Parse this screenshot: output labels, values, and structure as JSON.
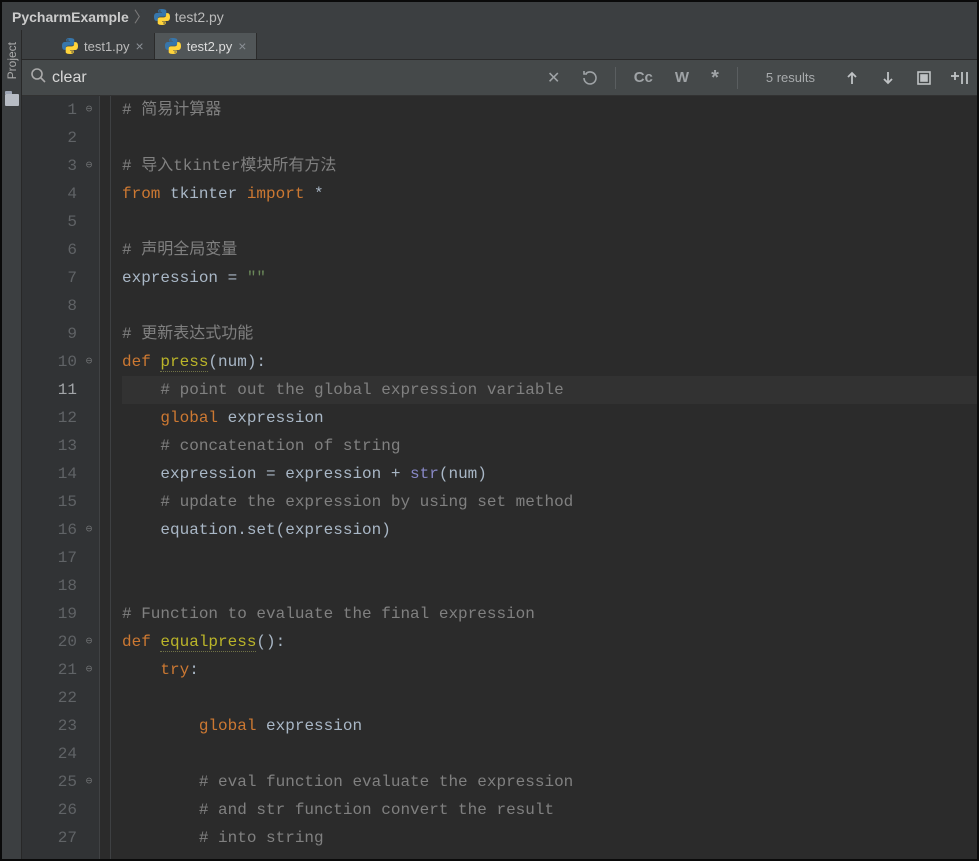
{
  "breadcrumb": {
    "project": "PycharmExample",
    "file": "test2.py"
  },
  "sidebar": {
    "project_label": "Project"
  },
  "tabs": [
    {
      "label": "test1.py",
      "active": false
    },
    {
      "label": "test2.py",
      "active": true
    }
  ],
  "findbar": {
    "query": "clear",
    "match_case": "Cc",
    "words": "W",
    "regex": "*",
    "results": "5 results"
  },
  "code": {
    "lines": [
      {
        "n": 1,
        "segs": [
          [
            "cm",
            "# 简易计算器"
          ]
        ]
      },
      {
        "n": 2,
        "segs": []
      },
      {
        "n": 3,
        "segs": [
          [
            "cm",
            "# 导入tkinter模块所有方法"
          ]
        ]
      },
      {
        "n": 4,
        "segs": [
          [
            "kw",
            "from "
          ],
          [
            "pl",
            "tkinter "
          ],
          [
            "kw",
            "import "
          ],
          [
            "pl",
            "*"
          ]
        ]
      },
      {
        "n": 5,
        "segs": []
      },
      {
        "n": 6,
        "segs": [
          [
            "cm",
            "# 声明全局变量"
          ]
        ]
      },
      {
        "n": 7,
        "segs": [
          [
            "pl",
            "expression = "
          ],
          [
            "st",
            "\"\""
          ]
        ]
      },
      {
        "n": 8,
        "segs": []
      },
      {
        "n": 9,
        "segs": [
          [
            "cm",
            "# 更新表达式功能"
          ]
        ]
      },
      {
        "n": 10,
        "segs": [
          [
            "kw",
            "def "
          ],
          [
            "sq",
            "press"
          ],
          [
            "pl",
            "(num):"
          ]
        ]
      },
      {
        "n": 11,
        "hl": true,
        "indent": 1,
        "segs": [
          [
            "cm",
            "# point out the global expression variable"
          ]
        ]
      },
      {
        "n": 12,
        "indent": 1,
        "segs": [
          [
            "kw",
            "global "
          ],
          [
            "pl",
            "expression"
          ]
        ]
      },
      {
        "n": 13,
        "indent": 1,
        "segs": [
          [
            "cm",
            "# concatenation of string"
          ]
        ]
      },
      {
        "n": 14,
        "indent": 1,
        "segs": [
          [
            "pl",
            "expression = expression + "
          ],
          [
            "bi",
            "str"
          ],
          [
            "pl",
            "(num)"
          ]
        ]
      },
      {
        "n": 15,
        "indent": 1,
        "segs": [
          [
            "cm",
            "# update the expression by using set method"
          ]
        ]
      },
      {
        "n": 16,
        "indent": 1,
        "segs": [
          [
            "pl",
            "equation.set(expression)"
          ]
        ]
      },
      {
        "n": 17,
        "segs": []
      },
      {
        "n": 18,
        "segs": []
      },
      {
        "n": 19,
        "segs": [
          [
            "cm",
            "# Function to evaluate the final expression"
          ]
        ]
      },
      {
        "n": 20,
        "segs": [
          [
            "kw",
            "def "
          ],
          [
            "sq",
            "equalpress"
          ],
          [
            "pl",
            "():"
          ]
        ]
      },
      {
        "n": 21,
        "indent": 1,
        "segs": [
          [
            "kw",
            "try"
          ],
          [
            "pl",
            ":"
          ]
        ]
      },
      {
        "n": 22,
        "segs": []
      },
      {
        "n": 23,
        "indent": 2,
        "segs": [
          [
            "kw",
            "global "
          ],
          [
            "pl",
            "expression"
          ]
        ]
      },
      {
        "n": 24,
        "segs": []
      },
      {
        "n": 25,
        "indent": 2,
        "segs": [
          [
            "cm",
            "# eval function evaluate the expression"
          ]
        ]
      },
      {
        "n": 26,
        "indent": 2,
        "segs": [
          [
            "cm",
            "# and str function convert the result"
          ]
        ]
      },
      {
        "n": 27,
        "indent": 2,
        "segs": [
          [
            "cm",
            "# into string"
          ]
        ]
      }
    ],
    "folds": [
      1,
      3,
      10,
      16,
      20,
      21,
      25
    ]
  }
}
